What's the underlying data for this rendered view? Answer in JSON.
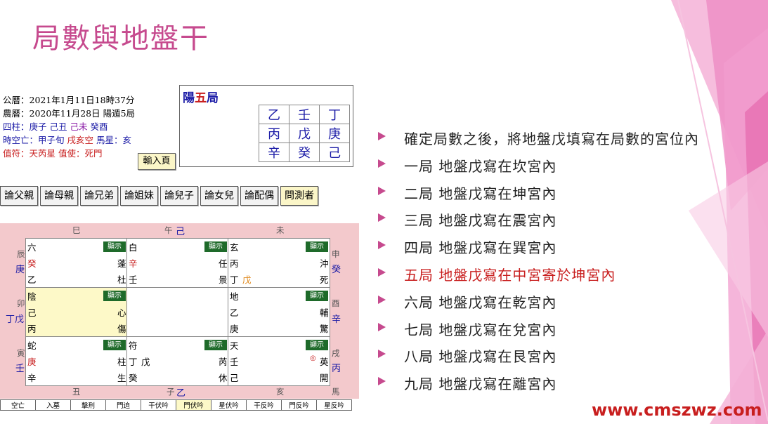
{
  "slide": {
    "title": "局數與地盤干",
    "watermark": "www.cmszwz.com"
  },
  "info": {
    "line1": "公曆：2021年1月11日18時37分",
    "line2": "農曆：2020年11月28日 陽遁5局",
    "line3_a": "四柱：庚子 己丑 ",
    "line3_b": "己未",
    "line3_c": " 癸酉",
    "line4_a": "時空亡：甲子旬 ",
    "line4_b": "戌亥空",
    "line4_c": " 馬星：亥",
    "line5": "值符：天芮星 值使：死門"
  },
  "input_button": "輸入頁",
  "ju": {
    "label_a": "陽",
    "label_b": "五",
    "label_c": "局",
    "grid": [
      [
        "乙",
        "壬",
        "丁"
      ],
      [
        "丙",
        "戊",
        "庚"
      ],
      [
        "辛",
        "癸",
        "己"
      ]
    ]
  },
  "relations": [
    "論父親",
    "論母親",
    "論兄弟",
    "論姐妹",
    "論兒子",
    "論女兒",
    "論配偶",
    "問測者"
  ],
  "board": {
    "show_label": "顯示",
    "top_branches": [
      "巳",
      "午",
      "未"
    ],
    "top_gan": "己",
    "bottom_branches": [
      "丑",
      "子",
      "亥",
      "馬"
    ],
    "bottom_gan": "乙",
    "left": [
      {
        "zhi": "辰",
        "gan": "庚"
      },
      {
        "zhi": "卯",
        "gan": "丁戊"
      },
      {
        "zhi": "寅",
        "gan": "壬"
      }
    ],
    "right": [
      {
        "zhi": "申",
        "gan": "癸"
      },
      {
        "zhi": "酉",
        "gan": "辛"
      },
      {
        "zhi": "戌",
        "gan": "丙"
      }
    ],
    "palaces": {
      "xun": {
        "god": "六",
        "tian": "癸",
        "di": "乙",
        "star": "蓬",
        "door": "杜"
      },
      "li": {
        "god": "白",
        "tian": "辛",
        "di": "壬",
        "star": "任",
        "door": "景"
      },
      "kun": {
        "god": "玄",
        "tian": "丙",
        "di": "丁",
        "extra": "戊",
        "star": "沖",
        "door": "死"
      },
      "zhen": {
        "god": "陰",
        "tian": "己",
        "di": "丙",
        "star": "心",
        "door": "傷"
      },
      "dui": {
        "god": "地",
        "tian": "乙",
        "di": "庚",
        "star": "輔",
        "door": "驚"
      },
      "gen": {
        "god": "蛇",
        "tian": "庚",
        "di": "辛",
        "star": "柱",
        "door": "生"
      },
      "kan": {
        "god": "符",
        "tian": "丁",
        "extra": "戊",
        "di": "癸",
        "star": "芮",
        "door": "休"
      },
      "qian": {
        "god": "天",
        "tian": "壬",
        "di": "己",
        "mark": "◎",
        "star": "英",
        "door": "開"
      }
    }
  },
  "footer": [
    "空亡",
    "入墓",
    "擊刑",
    "門迫",
    "干伏吟",
    "門伏吟",
    "星伏吟",
    "干反吟",
    "門反吟",
    "星反吟"
  ],
  "bullets": [
    "確定局數之後，將地盤戊填寫在局數的宮位內",
    "一局 地盤戊寫在坎宮內",
    "二局 地盤戊寫在坤宮內",
    "三局 地盤戊寫在震宮內",
    "四局 地盤戊寫在巽宮內",
    "五局 地盤戊寫在中宮寄於坤宮內",
    "六局 地盤戊寫在乾宮內",
    "七局 地盤戊寫在兌宮內",
    "八局 地盤戊寫在艮宮內",
    "九局 地盤戊寫在離宮內"
  ],
  "colors": {
    "accent": "#c64a8e",
    "highlight_text": "#c81e1e",
    "board_bg": "#f3c9cc",
    "show_button": "#1e6a2a"
  }
}
